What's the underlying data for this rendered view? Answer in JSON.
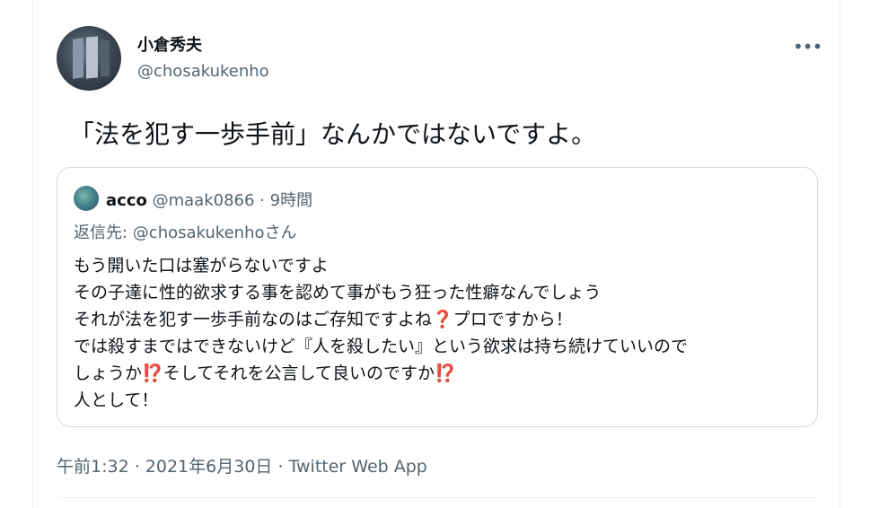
{
  "author": {
    "display_name": "小倉秀夫",
    "handle": "@chosakukenho"
  },
  "more_label": "•••",
  "tweet_text": "「法を犯す一歩手前」なんかではないですよ。",
  "quoted": {
    "display_name": "acco",
    "handle": "@maak0866",
    "separator": "·",
    "time": "9時間",
    "reply_prefix": "返信先: ",
    "reply_to": "@chosakukenho",
    "reply_suffix": "さん",
    "lines": [
      {
        "text": "もう開いた口は塞がらないですよ"
      },
      {
        "text": "その子達に性的欲求する事を認めて事がもう狂った性癖なんでしょう"
      },
      {
        "text": "それが法を犯す一歩手前なのはご存知ですよね",
        "emoji": "❓",
        "after": "プロですから！"
      },
      {
        "text": "では殺すまではできないけど『人を殺したい』という欲求は持ち続けていいので"
      },
      {
        "text": "しょうか",
        "emoji": "⁉️",
        "after": "そしてそれを公言して良いのですか",
        "emoji2": "⁉️"
      },
      {
        "text": "人として！"
      }
    ]
  },
  "timestamp": {
    "time": "午前1:32",
    "sep1": " · ",
    "date": "2021年6月30日",
    "sep2": " · ",
    "source": "Twitter Web App"
  },
  "colors": {
    "text": "#0f1419",
    "secondary": "#536471",
    "border": "#cfd9de",
    "emoji_red": "#be1931"
  }
}
